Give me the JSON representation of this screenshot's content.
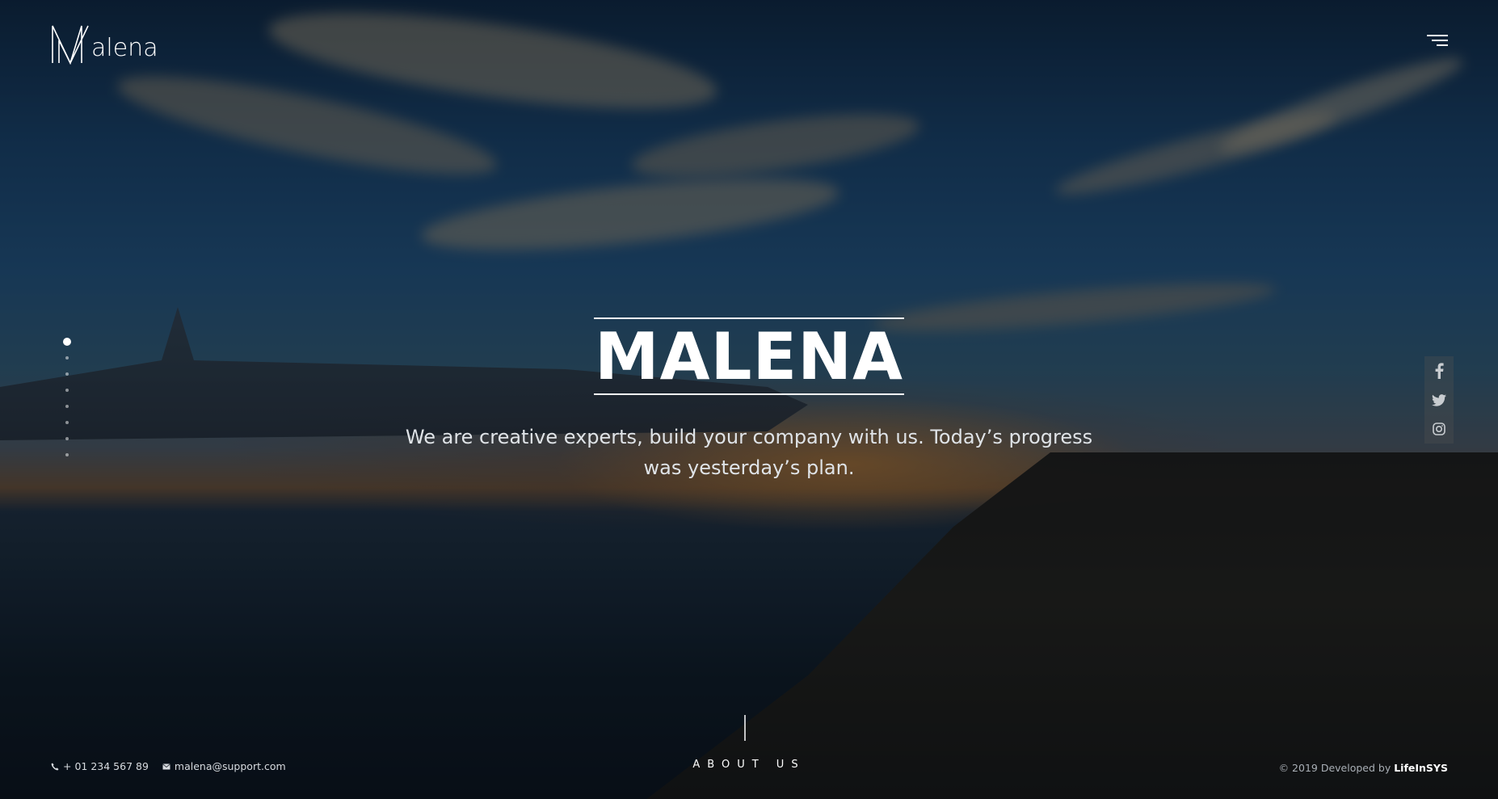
{
  "brand": {
    "logo_text": "alena"
  },
  "hero": {
    "title": "MALENA",
    "subtitle": "We are creative experts, build your company with us. Today’s progress was yesterday’s plan."
  },
  "slider": {
    "count": 8,
    "active_index": 0
  },
  "social": [
    {
      "icon": "facebook-icon"
    },
    {
      "icon": "twitter-icon"
    },
    {
      "icon": "instagram-icon"
    }
  ],
  "footer": {
    "phone": "+ 01 234 567 89",
    "email": "malena@support.com",
    "about_label": "ABOUT US",
    "copyright_prefix": "© 2019 Developed by",
    "developer": "LifeInSYS"
  },
  "colors": {
    "text": "#ffffff",
    "overlay": "#060c14"
  }
}
